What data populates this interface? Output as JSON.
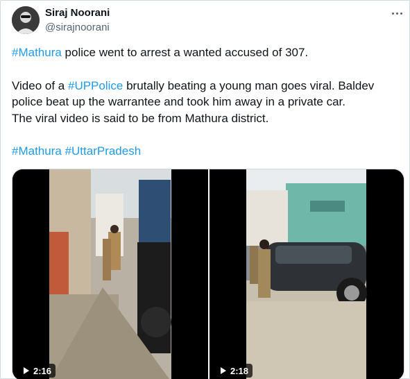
{
  "author": {
    "name": "Siraj Noorani",
    "handle": "@sirajnoorani"
  },
  "tweet": {
    "line1": {
      "tag": "#Mathura",
      "text": " police went to arrest a wanted accused of 307."
    },
    "line2": {
      "prefix": "Video of a ",
      "tag": "#UPPolice",
      "text": " brutally beating a young man goes viral. Baldev"
    },
    "line3": "police beat up the warrantee and took him away in a private car.",
    "line4": "The viral video is said to be from Mathura district.",
    "hashtags": [
      "#Mathura",
      "#UttarPradesh"
    ]
  },
  "media": {
    "videos": [
      {
        "duration": "2:16"
      },
      {
        "duration": "2:18"
      }
    ]
  },
  "icons": {
    "more": "more-options-icon",
    "play": "play-icon"
  }
}
